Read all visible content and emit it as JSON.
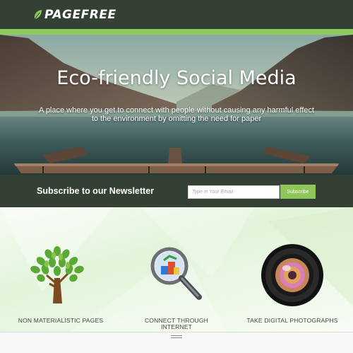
{
  "header": {
    "logo_text": "PAGEFREE",
    "logo_icon": "leaf-icon"
  },
  "hero": {
    "title": "Eco-friendly Social Media",
    "subtitle": "A place where you get to connect with people without causing any harmful effect to the environment by omitting the need for paper"
  },
  "newsletter": {
    "label": "Subscribe to our Newsletter",
    "placeholder": "Type in Your Email",
    "button_label": "Subscribe"
  },
  "features": [
    {
      "label": "NON MATERIALISTIC PAGES",
      "icon": "tree-icon"
    },
    {
      "label": "CONNECT THROUGH INTERNET",
      "icon": "magnifier-icon"
    },
    {
      "label": "TAKE DIGITAL PHOTOGRAPHS",
      "icon": "camera-lens-icon"
    }
  ],
  "colors": {
    "dark_green": "#344033",
    "accent_green": "#8ec65a",
    "text_white": "#ffffff"
  }
}
